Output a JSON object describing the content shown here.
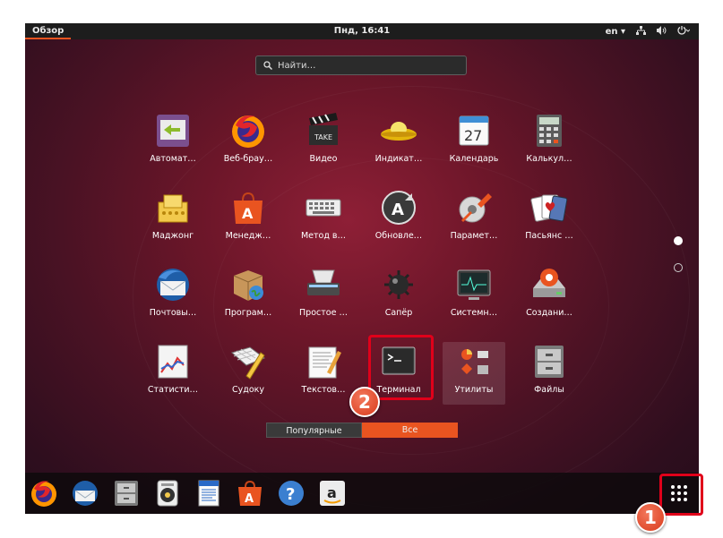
{
  "topbar": {
    "overview": "Обзор",
    "clock": "Пнд, 16:41",
    "lang": "en ▾"
  },
  "search": {
    "placeholder": "Найти…"
  },
  "apps": [
    {
      "label": "Автомат…",
      "icon": "automation-icon"
    },
    {
      "label": "Веб-брау…",
      "icon": "firefox-icon"
    },
    {
      "label": "Видео",
      "icon": "video-clapper-icon"
    },
    {
      "label": "Индикат…",
      "icon": "ufo-indicator-icon"
    },
    {
      "label": "Календарь",
      "icon": "calendar-icon",
      "day": "27"
    },
    {
      "label": "Калькул…",
      "icon": "calculator-icon"
    },
    {
      "label": "Маджонг",
      "icon": "mahjong-icon"
    },
    {
      "label": "Менедж…",
      "icon": "software-bag-icon"
    },
    {
      "label": "Метод в…",
      "icon": "keyboard-icon"
    },
    {
      "label": "Обновле…",
      "icon": "update-icon"
    },
    {
      "label": "Парамет…",
      "icon": "settings-icon"
    },
    {
      "label": "Пасьянс …",
      "icon": "cards-icon"
    },
    {
      "label": "Почтовы…",
      "icon": "thunderbird-icon"
    },
    {
      "label": "Програм…",
      "icon": "package-globe-icon"
    },
    {
      "label": "Простое …",
      "icon": "scanner-icon"
    },
    {
      "label": "Сапёр",
      "icon": "mine-icon"
    },
    {
      "label": "Системн…",
      "icon": "system-monitor-icon"
    },
    {
      "label": "Создани…",
      "icon": "disk-creator-icon"
    },
    {
      "label": "Статисти…",
      "icon": "statistics-icon"
    },
    {
      "label": "Судоку",
      "icon": "sudoku-icon"
    },
    {
      "label": "Текстов…",
      "icon": "text-editor-icon"
    },
    {
      "label": "Терминал",
      "icon": "terminal-icon"
    },
    {
      "label": "Утилиты",
      "icon": "utilities-folder-icon"
    },
    {
      "label": "Файлы",
      "icon": "files-cabinet-icon"
    }
  ],
  "tabs": {
    "popular": "Популярные",
    "all": "Все"
  },
  "annotations": {
    "one": "1",
    "two": "2"
  },
  "dock": [
    "firefox-icon",
    "thunderbird-icon",
    "files-icon",
    "rhythmbox-icon",
    "writer-icon",
    "software-icon",
    "help-icon",
    "amazon-icon"
  ],
  "colors": {
    "accent": "#e95420",
    "highlight": "#e0001a"
  }
}
